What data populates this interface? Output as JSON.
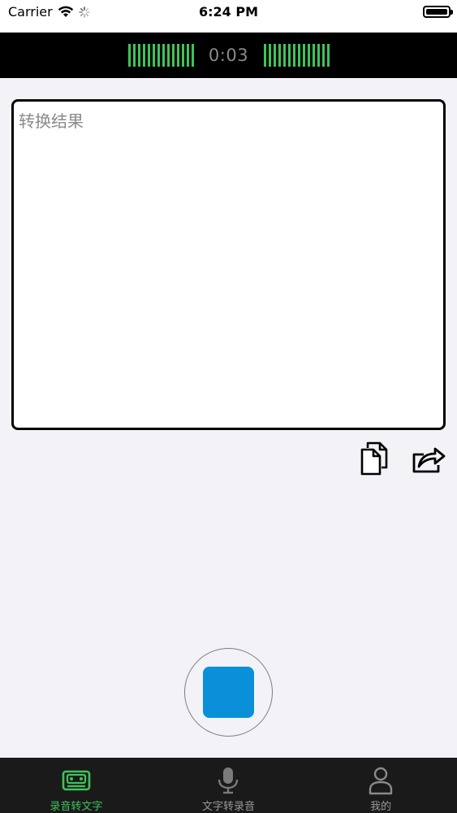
{
  "status_bar": {
    "carrier": "Carrier",
    "time": "6:24 PM"
  },
  "recording": {
    "elapsed": "0:03",
    "meter_color": "#3fc35a"
  },
  "result": {
    "placeholder": "转换结果"
  },
  "actions": {
    "copy_icon": "copy-icon",
    "share_icon": "share-icon"
  },
  "record_button": {
    "state": "recording",
    "color": "#0a90d9"
  },
  "tabs": [
    {
      "label": "录音转文字",
      "icon": "cassette-icon",
      "active": true
    },
    {
      "label": "文字转录音",
      "icon": "microphone-icon",
      "active": false
    },
    {
      "label": "我的",
      "icon": "person-icon",
      "active": false
    }
  ],
  "colors": {
    "accent": "#3fc35a",
    "tab_inactive": "#9a9a9a",
    "tab_bar_bg": "#1a1a1a"
  }
}
